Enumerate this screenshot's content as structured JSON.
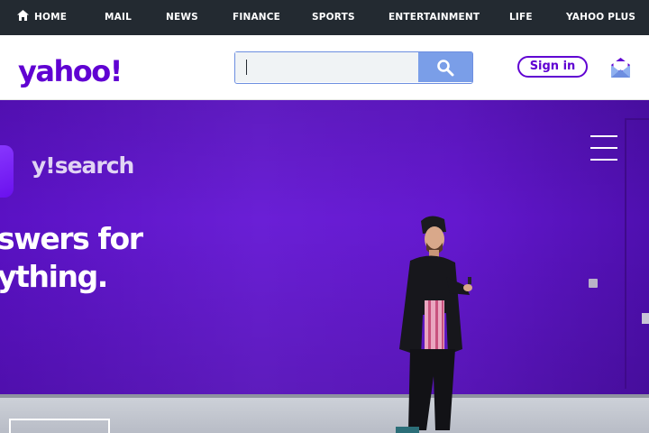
{
  "top_nav": {
    "items": [
      {
        "label": "HOME",
        "icon": "home-icon"
      },
      {
        "label": "MAIL"
      },
      {
        "label": "NEWS"
      },
      {
        "label": "FINANCE"
      },
      {
        "label": "SPORTS"
      },
      {
        "label": "ENTERTAINMENT"
      },
      {
        "label": "LIFE"
      },
      {
        "label": "YAHOO PLUS"
      }
    ]
  },
  "header": {
    "logo": "yahoo!",
    "search": {
      "value": "",
      "placeholder": "",
      "button_icon": "search-icon"
    },
    "signin_label": "Sign in",
    "mail_icon": "mail-icon"
  },
  "hero": {
    "brand": "y!search",
    "headline_line1": "swers for",
    "headline_line2": "ything.",
    "menu_icon": "hamburger-menu-icon"
  },
  "colors": {
    "nav_bg": "#232a31",
    "brand_purple": "#6001d2",
    "hero_purple": "#6a1fd6",
    "search_button": "#7a9ee8"
  }
}
